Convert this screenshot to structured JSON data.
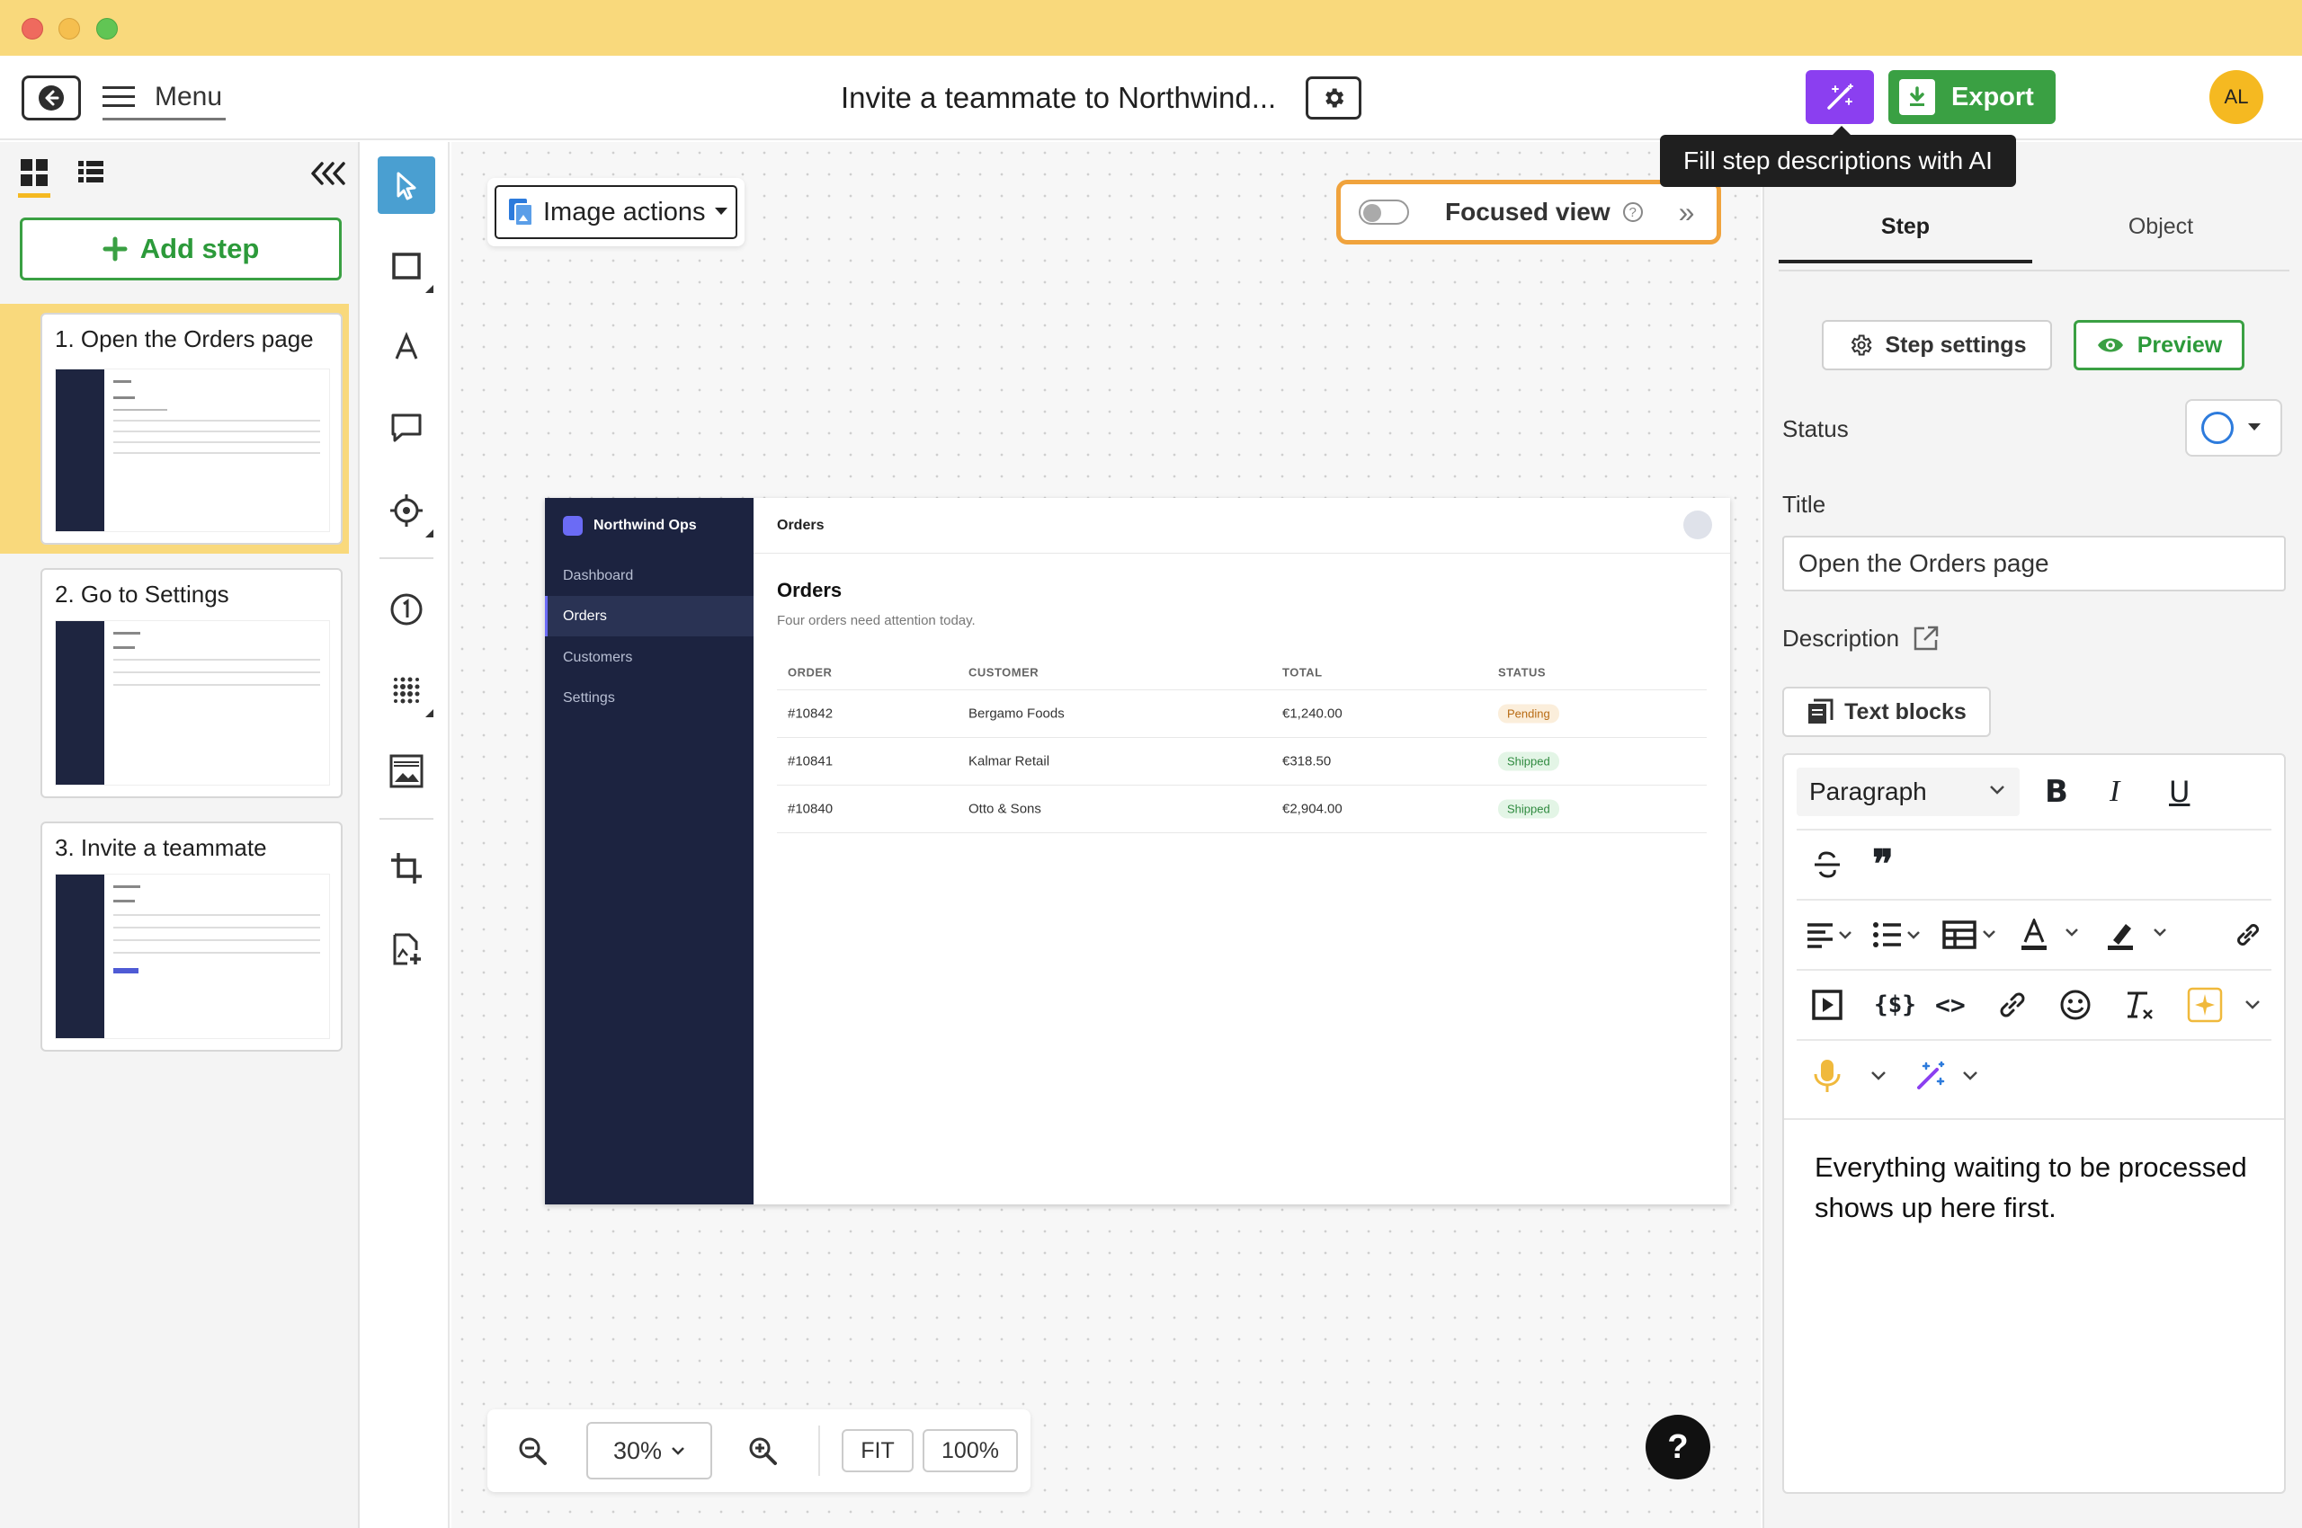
{
  "header": {
    "menu_label": "Menu",
    "doc_title": "Invite a teammate to Northwind...",
    "export_label": "Export",
    "avatar_initials": "AL",
    "ai_tooltip": "Fill step descriptions with AI",
    "ai_button_color": "#8b3ff0",
    "export_color": "#3aa043"
  },
  "sidebar": {
    "add_step_label": "Add step",
    "steps": [
      {
        "title": "1. Open the Orders page",
        "selected": true
      },
      {
        "title": "2. Go to Settings",
        "selected": false
      },
      {
        "title": "3. Invite a teammate",
        "selected": false
      }
    ]
  },
  "tools": [
    "select-pointer-icon",
    "rectangle-icon",
    "text-icon",
    "comment-icon",
    "target-icon",
    "step-number-icon",
    "blur-icon",
    "image-icon",
    "crop-icon",
    "add-image-icon"
  ],
  "canvas": {
    "image_actions_label": "Image actions",
    "focused_view_label": "Focused view",
    "focused_view_on": false,
    "zoom_level": "30%",
    "fit_label": "FIT",
    "hundred_label": "100%",
    "help_label": "?"
  },
  "screenshot": {
    "brand": "Northwind Ops",
    "nav": [
      "Dashboard",
      "Orders",
      "Customers",
      "Settings"
    ],
    "active_nav": "Orders",
    "top_title": "Orders",
    "heading": "Orders",
    "subheading": "Four orders need attention today.",
    "columns": [
      "ORDER",
      "CUSTOMER",
      "TOTAL",
      "STATUS"
    ],
    "rows": [
      {
        "order": "#10842",
        "customer": "Bergamo Foods",
        "total": "€1,240.00",
        "status": "Pending"
      },
      {
        "order": "#10841",
        "customer": "Kalmar Retail",
        "total": "€318.50",
        "status": "Shipped"
      },
      {
        "order": "#10840",
        "customer": "Otto & Sons",
        "total": "€2,904.00",
        "status": "Shipped"
      }
    ]
  },
  "right_panel": {
    "tabs": [
      "Step",
      "Object"
    ],
    "active_tab": "Step",
    "step_settings_label": "Step settings",
    "preview_label": "Preview",
    "status_label": "Status",
    "title_label": "Title",
    "title_value": "Open the Orders page",
    "description_label": "Description",
    "text_blocks_label": "Text blocks",
    "paragraph_select": "Paragraph",
    "description_text": "Everything waiting to be processed shows up here first."
  }
}
